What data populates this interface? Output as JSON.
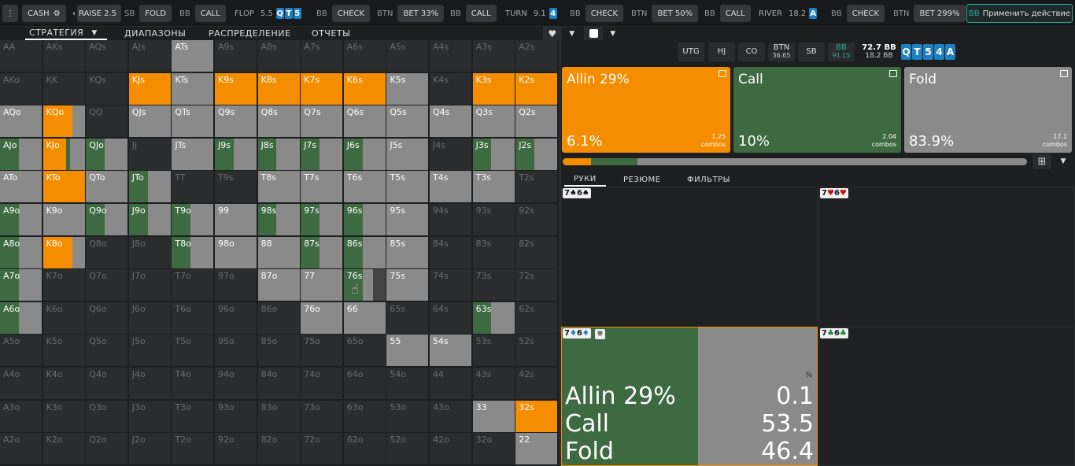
{
  "topbar": {
    "menu_icon": "kebab-menu-icon",
    "game_type": "CASH",
    "actions": [
      {
        "pos": "",
        "label": "RAISE 2.5"
      },
      {
        "pos": "SB",
        "label": "FOLD"
      },
      {
        "pos": "BB",
        "label": "CALL"
      }
    ],
    "flop": {
      "label": "FLOP",
      "pot": "5.5",
      "cards": [
        "Q",
        "T",
        "5"
      ]
    },
    "flop_actions": [
      {
        "pos": "BB",
        "label": "CHECK"
      },
      {
        "pos": "BTN",
        "label": "BET 33%"
      },
      {
        "pos": "BB",
        "label": "CALL"
      }
    ],
    "turn": {
      "label": "TURN",
      "pot": "9.1",
      "cards": [
        "4"
      ]
    },
    "turn_actions": [
      {
        "pos": "BB",
        "label": "CHECK"
      },
      {
        "pos": "BTN",
        "label": "BET 50%"
      },
      {
        "pos": "BB",
        "label": "CALL"
      }
    ],
    "river": {
      "label": "RIVER",
      "pot": "18.2",
      "cards": [
        "A"
      ]
    },
    "river_actions": [
      {
        "pos": "BB",
        "label": "CHECK"
      },
      {
        "pos": "BTN",
        "label": "BET 299%"
      }
    ],
    "apply": {
      "pos": "BB",
      "label": "Применить действие"
    }
  },
  "tabs": [
    {
      "label": "СТРАТЕГИЯ"
    },
    {
      "label": "ДИАПАЗОНЫ"
    },
    {
      "label": "РАСПРЕДЕЛЕНИЕ"
    },
    {
      "label": "ОТЧЕТЫ"
    }
  ],
  "colors": {
    "allin": "#f48d00",
    "call": "#3e6a41",
    "fold": "#8a8a8a",
    "empty": "#2b2c2e",
    "board": "#1f7fc0",
    "accent": "#2aa9a0"
  },
  "grid": [
    [
      [
        "AA",
        "e"
      ],
      [
        "AKs",
        "e"
      ],
      [
        "AQs",
        "e"
      ],
      [
        "AJs",
        "e"
      ],
      [
        "ATs",
        "f"
      ],
      [
        "A9s",
        "e"
      ],
      [
        "A8s",
        "e"
      ],
      [
        "A7s",
        "e"
      ],
      [
        "A6s",
        "e"
      ],
      [
        "A5s",
        "e"
      ],
      [
        "A4s",
        "e"
      ],
      [
        "A3s",
        "e"
      ],
      [
        "A2s",
        "e"
      ]
    ],
    [
      [
        "AKo",
        "e"
      ],
      [
        "KK",
        "e"
      ],
      [
        "KQs",
        "e"
      ],
      [
        "KJs",
        "a"
      ],
      [
        "KTs",
        "f"
      ],
      [
        "K9s",
        "a"
      ],
      [
        "K8s",
        "a"
      ],
      [
        "K7s",
        "a"
      ],
      [
        "K6s",
        "a"
      ],
      [
        "K5s",
        "f"
      ],
      [
        "K4s",
        "e"
      ],
      [
        "K3s",
        "a"
      ],
      [
        "K2s",
        "a"
      ]
    ],
    [
      [
        "AQo",
        "f"
      ],
      [
        "KQo",
        "af"
      ],
      [
        "QQ",
        "e"
      ],
      [
        "QJs",
        "f"
      ],
      [
        "QTs",
        "f"
      ],
      [
        "Q9s",
        "f"
      ],
      [
        "Q8s",
        "f"
      ],
      [
        "Q7s",
        "f"
      ],
      [
        "Q6s",
        "f"
      ],
      [
        "Q5s",
        "f"
      ],
      [
        "Q4s",
        "f"
      ],
      [
        "Q3s",
        "f"
      ],
      [
        "Q2s",
        "f"
      ]
    ],
    [
      [
        "AJo",
        "cf"
      ],
      [
        "KJo",
        "acf"
      ],
      [
        "QJo",
        "cf"
      ],
      [
        "JJ",
        "e"
      ],
      [
        "JTs",
        "f"
      ],
      [
        "J9s",
        "cf"
      ],
      [
        "J8s",
        "cf"
      ],
      [
        "J7s",
        "cf"
      ],
      [
        "J6s",
        "cf"
      ],
      [
        "J5s",
        "f"
      ],
      [
        "J4s",
        "e"
      ],
      [
        "J3s",
        "cf"
      ],
      [
        "J2s",
        "cf"
      ]
    ],
    [
      [
        "ATo",
        "f"
      ],
      [
        "KTo",
        "a"
      ],
      [
        "QTo",
        "f"
      ],
      [
        "JTo",
        "cf"
      ],
      [
        "TT",
        "e"
      ],
      [
        "T9s",
        "e"
      ],
      [
        "T8s",
        "f"
      ],
      [
        "T7s",
        "f"
      ],
      [
        "T6s",
        "f"
      ],
      [
        "T5s",
        "f"
      ],
      [
        "T4s",
        "f"
      ],
      [
        "T3s",
        "f"
      ],
      [
        "T2s",
        "e"
      ]
    ],
    [
      [
        "A9o",
        "cf"
      ],
      [
        "K9o",
        "f"
      ],
      [
        "Q9o",
        "cf"
      ],
      [
        "J9o",
        "cf"
      ],
      [
        "T9o",
        "cf"
      ],
      [
        "99",
        "f"
      ],
      [
        "98s",
        "cf"
      ],
      [
        "97s",
        "cf"
      ],
      [
        "96s",
        "cf"
      ],
      [
        "95s",
        "f"
      ],
      [
        "94s",
        "e"
      ],
      [
        "93s",
        "e"
      ],
      [
        "92s",
        "e"
      ]
    ],
    [
      [
        "A8o",
        "cf"
      ],
      [
        "K8o",
        "af"
      ],
      [
        "Q8o",
        "e"
      ],
      [
        "J8o",
        "e"
      ],
      [
        "T8o",
        "cf"
      ],
      [
        "98o",
        "f"
      ],
      [
        "88",
        "f"
      ],
      [
        "87s",
        "cf"
      ],
      [
        "86s",
        "cf"
      ],
      [
        "85s",
        "f"
      ],
      [
        "84s",
        "e"
      ],
      [
        "83s",
        "e"
      ],
      [
        "82s",
        "e"
      ]
    ],
    [
      [
        "A7o",
        "cf"
      ],
      [
        "K7o",
        "e"
      ],
      [
        "Q7o",
        "e"
      ],
      [
        "J7o",
        "e"
      ],
      [
        "T7o",
        "e"
      ],
      [
        "97o",
        "e"
      ],
      [
        "87o",
        "f"
      ],
      [
        "77",
        "f"
      ],
      [
        "76s",
        "cfd"
      ],
      [
        "75s",
        "f"
      ],
      [
        "74s",
        "e"
      ],
      [
        "73s",
        "e"
      ],
      [
        "72s",
        "e"
      ]
    ],
    [
      [
        "A6o",
        "cf"
      ],
      [
        "K6o",
        "e"
      ],
      [
        "Q6o",
        "e"
      ],
      [
        "J6o",
        "e"
      ],
      [
        "T6o",
        "e"
      ],
      [
        "96o",
        "e"
      ],
      [
        "86o",
        "e"
      ],
      [
        "76o",
        "f"
      ],
      [
        "66",
        "f"
      ],
      [
        "65s",
        "e"
      ],
      [
        "64s",
        "e"
      ],
      [
        "63s",
        "cf"
      ],
      [
        "62s",
        "e"
      ]
    ],
    [
      [
        "A5o",
        "e"
      ],
      [
        "K5o",
        "e"
      ],
      [
        "Q5o",
        "e"
      ],
      [
        "J5o",
        "e"
      ],
      [
        "T5o",
        "e"
      ],
      [
        "95o",
        "e"
      ],
      [
        "85o",
        "e"
      ],
      [
        "75o",
        "e"
      ],
      [
        "65o",
        "e"
      ],
      [
        "55",
        "f"
      ],
      [
        "54s",
        "f"
      ],
      [
        "53s",
        "e"
      ],
      [
        "52s",
        "e"
      ]
    ],
    [
      [
        "A4o",
        "e"
      ],
      [
        "K4o",
        "e"
      ],
      [
        "Q4o",
        "e"
      ],
      [
        "J4o",
        "e"
      ],
      [
        "T4o",
        "e"
      ],
      [
        "94o",
        "e"
      ],
      [
        "84o",
        "e"
      ],
      [
        "74o",
        "e"
      ],
      [
        "64o",
        "e"
      ],
      [
        "54o",
        "e"
      ],
      [
        "44",
        "e"
      ],
      [
        "43s",
        "e"
      ],
      [
        "42s",
        "e"
      ]
    ],
    [
      [
        "A3o",
        "e"
      ],
      [
        "K3o",
        "e"
      ],
      [
        "Q3o",
        "e"
      ],
      [
        "J3o",
        "e"
      ],
      [
        "T3o",
        "e"
      ],
      [
        "93o",
        "e"
      ],
      [
        "83o",
        "e"
      ],
      [
        "73o",
        "e"
      ],
      [
        "63o",
        "e"
      ],
      [
        "53o",
        "e"
      ],
      [
        "43o",
        "e"
      ],
      [
        "33",
        "f"
      ],
      [
        "32s",
        "a"
      ]
    ],
    [
      [
        "A2o",
        "e"
      ],
      [
        "K2o",
        "e"
      ],
      [
        "Q2o",
        "e"
      ],
      [
        "J2o",
        "e"
      ],
      [
        "T2o",
        "e"
      ],
      [
        "92o",
        "e"
      ],
      [
        "82o",
        "e"
      ],
      [
        "72o",
        "e"
      ],
      [
        "62o",
        "e"
      ],
      [
        "52o",
        "e"
      ],
      [
        "42o",
        "e"
      ],
      [
        "32o",
        "e"
      ],
      [
        "22",
        "f"
      ]
    ]
  ],
  "right": {
    "positions": [
      {
        "label": "UTG",
        "sub": ""
      },
      {
        "label": "HJ",
        "sub": ""
      },
      {
        "label": "CO",
        "sub": ""
      },
      {
        "label": "BTN",
        "sub": "36.65"
      },
      {
        "label": "SB",
        "sub": ""
      },
      {
        "label": "BB",
        "sub": "91.15"
      }
    ],
    "pot": {
      "line1": "72.7 BB",
      "line2": "18.2 BB"
    },
    "board": [
      "Q",
      "T",
      "5",
      "4",
      "A"
    ],
    "actions": [
      {
        "title": "Allin 29%",
        "pct": "6.1%",
        "combos": "1.25",
        "combos_label": "combos",
        "color": "#f48d00"
      },
      {
        "title": "Call",
        "pct": "10%",
        "combos": "2.04",
        "combos_label": "combos",
        "color": "#3e6a41"
      },
      {
        "title": "Fold",
        "pct": "83.9%",
        "combos": "17.1",
        "combos_label": "combos",
        "color": "#8a8a8a"
      }
    ],
    "freq": {
      "allin": 0.061,
      "call": 0.1,
      "fold": 0.839
    },
    "subtabs": [
      {
        "label": "РУКИ"
      },
      {
        "label": "РЕЗЮМЕ"
      },
      {
        "label": "ФИЛЬТРЫ"
      }
    ],
    "combos": [
      {
        "r1": "7",
        "s1": "♠",
        "r2": "6",
        "s2": "♠",
        "suit": "s"
      },
      {
        "r1": "7",
        "s1": "♥",
        "r2": "6",
        "s2": "♥",
        "suit": "h"
      },
      {
        "r1": "7",
        "s1": "♦",
        "r2": "6",
        "s2": "♦",
        "suit": "d"
      },
      {
        "r1": "7",
        "s1": "♣",
        "r2": "6",
        "s2": "♣",
        "suit": "c"
      }
    ],
    "detail": {
      "unit": "%",
      "rows": [
        {
          "label": "Allin 29%",
          "value": "0.1"
        },
        {
          "label": "Call",
          "value": "53.5"
        },
        {
          "label": "Fold",
          "value": "46.4"
        }
      ],
      "call_share": 0.535
    }
  }
}
